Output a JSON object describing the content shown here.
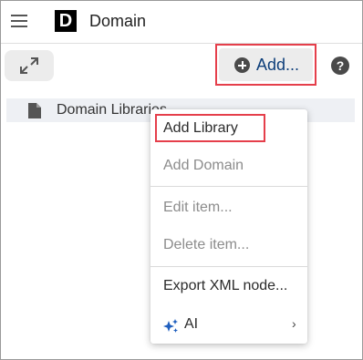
{
  "header": {
    "logo_letter": "D",
    "title": "Domain"
  },
  "toolbar": {
    "add_label": "Add...",
    "help_label": "?"
  },
  "tree": {
    "items": [
      {
        "label": "Domain Libraries"
      }
    ]
  },
  "context_menu": {
    "items": [
      {
        "label": "Add Library",
        "enabled": true
      },
      {
        "label": "Add Domain",
        "enabled": false
      },
      {
        "label": "Edit item...",
        "enabled": false
      },
      {
        "label": "Delete item...",
        "enabled": false
      },
      {
        "label": "Export XML node...",
        "enabled": true
      },
      {
        "label": "AI",
        "enabled": true,
        "has_submenu": true
      }
    ],
    "submenu_indicator": "›"
  },
  "icons": {
    "menu": "hamburger-icon",
    "logo": "d-logo-icon",
    "expand": "expand-icon",
    "add": "plus-circle-icon",
    "help": "help-icon",
    "file": "file-icon",
    "ai": "sparkle-icon"
  },
  "colors": {
    "highlight_outline": "#e53f4b",
    "add_text": "#0d3e7a",
    "ai_icon": "#1f5fbf"
  }
}
